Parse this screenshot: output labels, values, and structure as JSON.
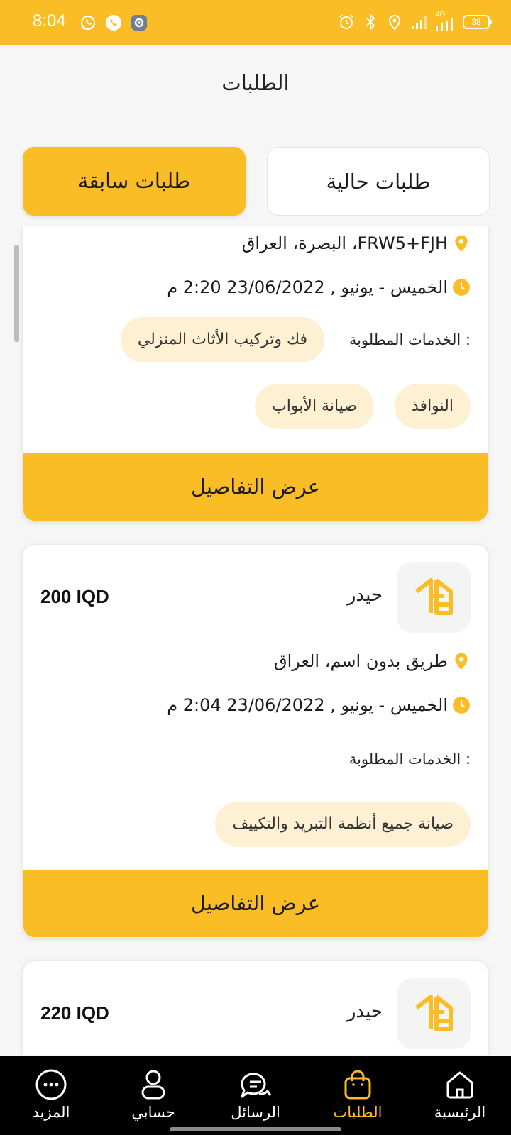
{
  "status_bar": {
    "time": "8:04",
    "battery": "38",
    "network": "4G"
  },
  "page": {
    "title": "الطلبات"
  },
  "tabs": {
    "current": "طلبات حالية",
    "past": "طلبات سابقة"
  },
  "orders": [
    {
      "address": "البصرة، العراق ،FRW5+FJH",
      "date": "الخميس - يونيو , 23/06/2022 2:20 م",
      "services_label": "الخدمات المطلوبة :",
      "services": [
        "فك وتركيب الأثاث المنزلي",
        "النوافذ",
        "صيانة الأبواب"
      ],
      "details_button": "عرض التفاصيل"
    },
    {
      "name": "حيدر",
      "price": "200 IQD",
      "address": "طريق بدون اسم، العراق",
      "date": "الخميس - يونيو , 23/06/2022 2:04 م",
      "services_label": "الخدمات المطلوبة :",
      "services": [
        "صيانة جميع أنظمة التبريد والتكييف"
      ],
      "details_button": "عرض التفاصيل"
    },
    {
      "name": "حيدر",
      "price": "220 IQD"
    }
  ],
  "bottom_nav": [
    {
      "label": "الرئيسية",
      "icon": "home-icon"
    },
    {
      "label": "الطلبات",
      "icon": "bag-icon",
      "active": true
    },
    {
      "label": "الرسائل",
      "icon": "chat-icon"
    },
    {
      "label": "حسابي",
      "icon": "user-icon"
    },
    {
      "label": "المزيد",
      "icon": "more-icon"
    }
  ],
  "colors": {
    "accent": "#fbbd26",
    "chip_bg": "#fdf0d3",
    "nav_bg": "#000000"
  }
}
